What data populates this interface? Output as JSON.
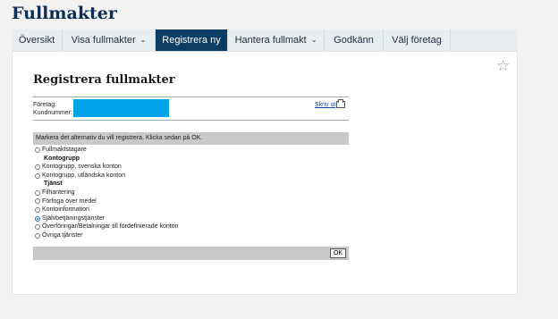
{
  "page": {
    "title": "Fullmakter"
  },
  "tabs": [
    {
      "label": "Översikt",
      "has_dropdown": false,
      "active": false
    },
    {
      "label": "Visa fullmakter",
      "has_dropdown": true,
      "active": false
    },
    {
      "label": "Registrera ny",
      "has_dropdown": false,
      "active": true
    },
    {
      "label": "Hantera fullmakt",
      "has_dropdown": true,
      "active": false
    },
    {
      "label": "Godkänn",
      "has_dropdown": false,
      "active": false
    },
    {
      "label": "Välj företag",
      "has_dropdown": false,
      "active": false
    }
  ],
  "card": {
    "favorite_icon": "star-outline-icon",
    "form_title": "Registrera fullmakter",
    "company_label": "Företag:",
    "customer_number_label": "Kundnummer:",
    "print_link": "Skriv ut",
    "print_icon": "printer-icon",
    "instruction": "Markera det alternativ du vill registrera. Klicka sedan på OK.",
    "options": [
      {
        "type": "radio",
        "label": "Fullmaktstagare",
        "checked": false
      },
      {
        "type": "heading",
        "label": "Kontogrupp"
      },
      {
        "type": "radio",
        "label": "Kontogrupp, svenska konton",
        "checked": false
      },
      {
        "type": "radio",
        "label": "Kontogrupp, utländska konton",
        "checked": false
      },
      {
        "type": "heading",
        "label": "Tjänst"
      },
      {
        "type": "radio",
        "label": "Filhantering",
        "checked": false
      },
      {
        "type": "radio",
        "label": "Förfoga över medel",
        "checked": false
      },
      {
        "type": "radio",
        "label": "Kontoinformation",
        "checked": false
      },
      {
        "type": "radio",
        "label": "Självbetjäningstjänster",
        "checked": true
      },
      {
        "type": "radio",
        "label": "Överföringar/Betalningar till fördefinierade konton",
        "checked": false
      },
      {
        "type": "radio",
        "label": "Övriga tjänster",
        "checked": false
      }
    ],
    "ok_label": "OK"
  },
  "colors": {
    "brand_navy": "#0b2d55",
    "active_tab": "#0b3d65",
    "redaction": "#00a2e8",
    "bar_gray": "#c9c9c9"
  }
}
